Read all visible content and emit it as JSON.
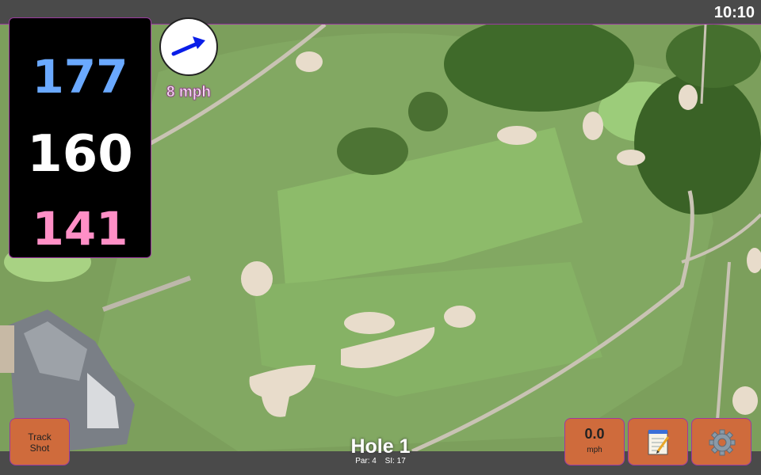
{
  "status": {
    "time": "10:10"
  },
  "distances": {
    "back": "177",
    "middle": "160",
    "front": "141"
  },
  "wind": {
    "speed_text": "8 mph",
    "icon": "arrow-icon",
    "arrow_color": "#0a1ee8"
  },
  "hole": {
    "title": "Hole 1",
    "par": "Par: 4",
    "si": "SI: 17"
  },
  "buttons": {
    "track_shot": [
      "Track",
      "Shot"
    ],
    "speed_value": "0.0",
    "speed_unit": "mph",
    "notes_icon": "notepad-icon",
    "settings_icon": "gear-icon"
  },
  "colors": {
    "button_bg": "#cf6b3c",
    "accent_border": "#9b3aa0",
    "panel_bg": "#000000",
    "back_color": "#6aa9ff",
    "front_color": "#ff8fc6"
  }
}
